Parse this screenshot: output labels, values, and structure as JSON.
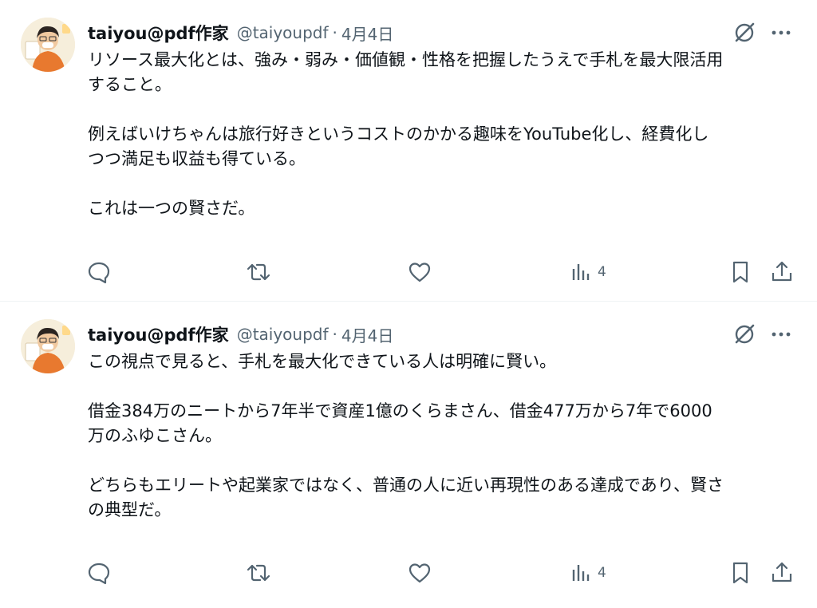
{
  "tweets": [
    {
      "author_name": "taiyou@pdf作家",
      "handle": "@taiyoupdf",
      "separator": "·",
      "date": "4月4日",
      "text": "リソース最大化とは、強み・弱み・価値観・性格を把握したうえで手札を最大限活用\nすること。\n\n例えばいけちゃんは旅行好きというコストのかかる趣味をYouTube化し、経費化し\nつつ満足も収益も得ている。\n\nこれは一つの賢さだ。",
      "views": "4"
    },
    {
      "author_name": "taiyou@pdf作家",
      "handle": "@taiyoupdf",
      "separator": "·",
      "date": "4月4日",
      "text": "この視点で見ると、手札を最大化できている人は明確に賢い。\n\n借金384万のニートから7年半で資産1億のくらまさん、借金477万から7年で6000\n万のふゆこさん。\n\nどちらもエリートや起業家ではなく、普通の人に近い再現性のある達成であり、賢さ\nの典型だ。",
      "views": "4"
    }
  ],
  "icons": {
    "grok": "grok-icon",
    "more": "more-icon",
    "reply": "reply-icon",
    "retweet": "retweet-icon",
    "like": "like-icon",
    "views": "views-icon",
    "bookmark": "bookmark-icon",
    "share": "share-icon"
  },
  "colors": {
    "text": "#0f1419",
    "secondary": "#536471",
    "divider": "#eff3f4"
  }
}
